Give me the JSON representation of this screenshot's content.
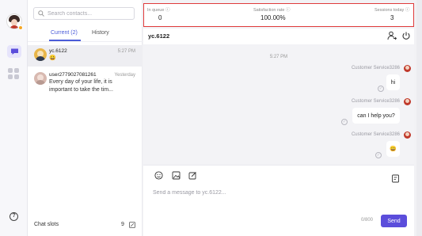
{
  "nav": {
    "icons": [
      "user-avatar",
      "chat-icon",
      "apps-icon",
      "help-icon"
    ],
    "help_glyph": "?"
  },
  "contacts": {
    "search_placeholder": "Search contacts...",
    "tabs": [
      {
        "label": "Current (2)",
        "active": true
      },
      {
        "label": "History",
        "active": false
      }
    ],
    "items": [
      {
        "name": "yc.6122",
        "time": "5:27 PM",
        "preview": "😀",
        "selected": true
      },
      {
        "name": "user2779027081261",
        "time": "Yesterday",
        "preview": "Every day of your life, it is important to take the tim...",
        "selected": false
      }
    ],
    "footer_label": "Chat slots",
    "slots_count": "9"
  },
  "stats": {
    "in_queue_label": "In queue",
    "in_queue_value": "0",
    "satisfaction_label": "Satisfaction rate",
    "satisfaction_value": "100.00%",
    "sessions_label": "Sessions today",
    "sessions_value": "3",
    "highlight_color": "#e03b3b"
  },
  "chat": {
    "title": "yc.6122",
    "timestamp": "5:27 PM",
    "messages": [
      {
        "sender": "Customer Service3286",
        "text": "hi"
      },
      {
        "sender": "Customer Service3286",
        "text": "can I help you?"
      },
      {
        "sender": "Customer Service3286",
        "text": "😀"
      }
    ],
    "input_placeholder": "Send a message to yc.6122...",
    "counter": "0/800",
    "send_label": "Send",
    "accent_color": "#5b4ddb"
  }
}
